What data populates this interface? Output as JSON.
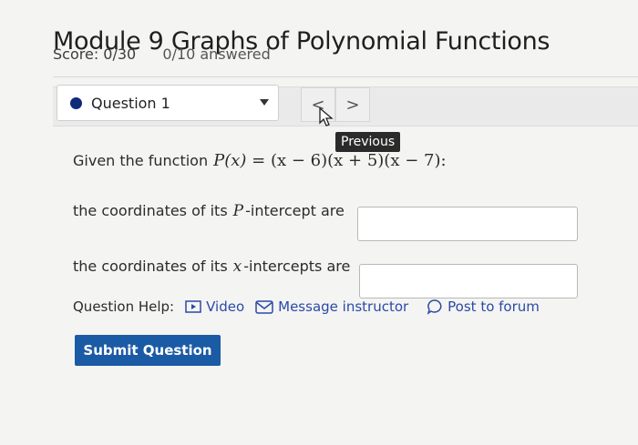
{
  "header": {
    "title": "Module 9 Graphs of Polynomial Functions",
    "score": "Score: 0/30",
    "answered": "0/10 answered"
  },
  "question_nav": {
    "selected": "Question 1",
    "prev_symbol": "<",
    "next_symbol": ">",
    "tooltip": "Previous"
  },
  "question": {
    "intro": "Given the function",
    "func_name": "P(x)",
    "func_expr": "= (x − 6)(x + 5)(x − 7):",
    "p_intercept_prefix": "the coordinates of its",
    "p_intercept_var": "P",
    "p_intercept_suffix": "-intercept are",
    "x_intercept_prefix": "the coordinates of its",
    "x_intercept_var": "x",
    "x_intercept_suffix": "-intercepts are",
    "p_intercept_value": "",
    "x_intercept_value": ""
  },
  "help": {
    "label": "Question Help:",
    "video": "Video",
    "message": "Message instructor",
    "forum": "Post to forum"
  },
  "actions": {
    "submit": "Submit Question"
  },
  "colors": {
    "submit_bg": "#1b5aa5",
    "link": "#2a4aa8",
    "question_dot": "#102a7a"
  }
}
